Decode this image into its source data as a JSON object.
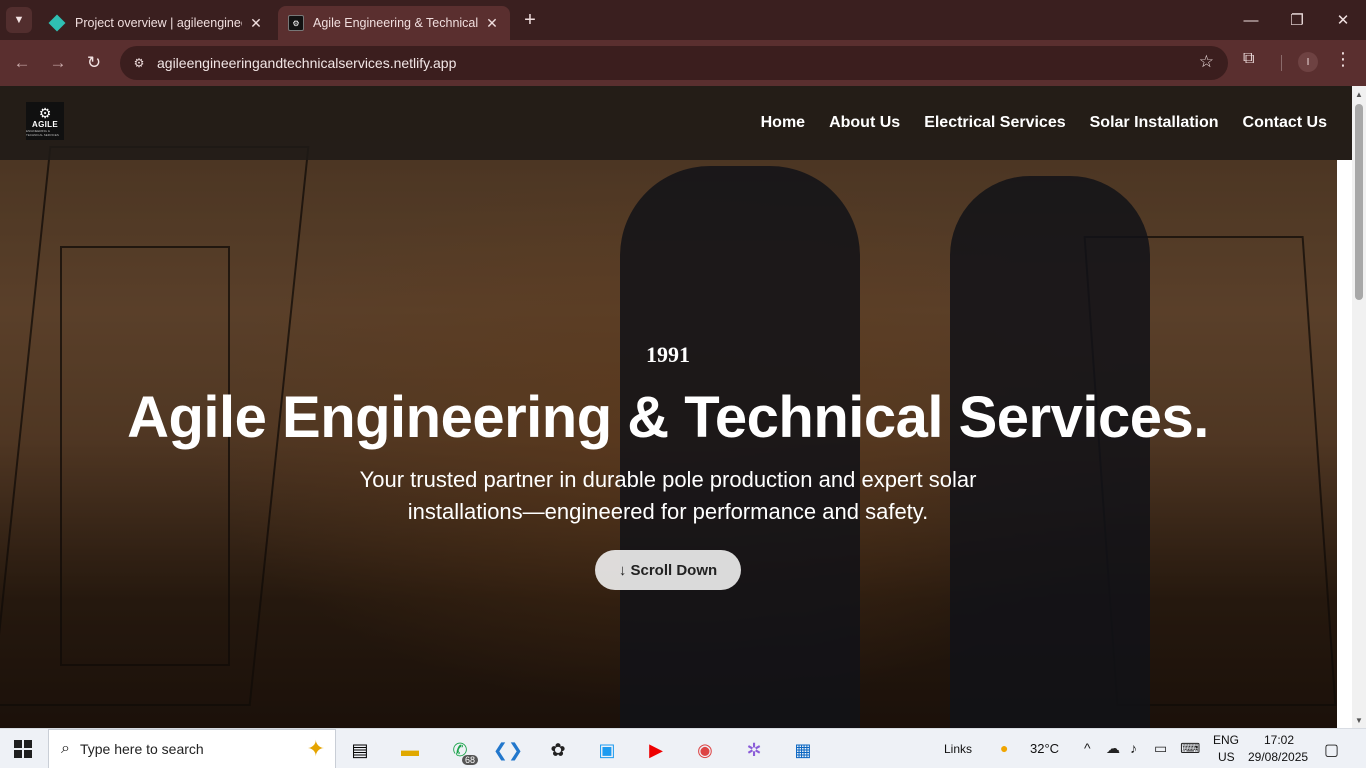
{
  "browser": {
    "tabs": [
      {
        "title": "Project overview | agileengineer",
        "active": false
      },
      {
        "title": "Agile Engineering & Technical S",
        "active": true
      }
    ],
    "url": "agileengineeringandtechnicalservices.netlify.app",
    "profile_initial": "I"
  },
  "site": {
    "logo_text": "AGILE",
    "logo_subtext": "ENGINEERING & TECHNICAL SERVICES",
    "nav": [
      "Home",
      "About Us",
      "Electrical Services",
      "Solar Installation",
      "Contact Us"
    ],
    "hero": {
      "year": "1991",
      "title": "Agile Engineering & Technical Services.",
      "subtitle_line1": "Your trusted partner in durable pole production and expert solar",
      "subtitle_line2": "installations—engineered for performance and safety.",
      "scroll_button": "↓ Scroll Down"
    }
  },
  "taskbar": {
    "search_placeholder": "Type here to search",
    "whatsapp_badge": "68",
    "links_label": "Links",
    "temperature": "32°C",
    "lang_line1": "ENG",
    "lang_line2": "US",
    "time": "17:02",
    "date": "29/08/2025"
  }
}
